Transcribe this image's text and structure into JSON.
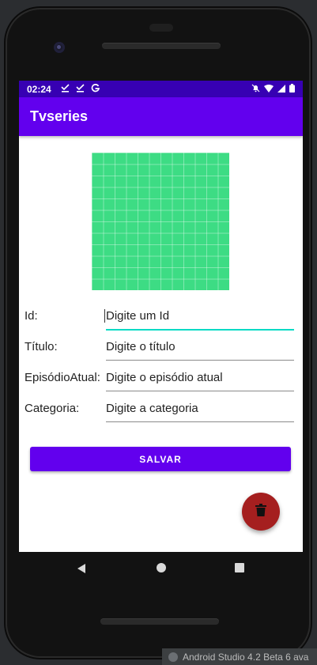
{
  "status_bar": {
    "time": "02:24",
    "left_icons": [
      "download-done-icon",
      "download-done-icon",
      "google-icon"
    ],
    "right_icons": [
      "notifications-off-icon",
      "wifi-icon",
      "signal-icon",
      "battery-icon"
    ]
  },
  "app_bar": {
    "title": "Tvseries"
  },
  "form": {
    "fields": [
      {
        "label": "Id:",
        "placeholder": "Digite um Id",
        "focused": true
      },
      {
        "label": "Título:",
        "placeholder": "Digite o título"
      },
      {
        "label": "EpisódioAtual:",
        "placeholder": "Digite o episódio atual"
      },
      {
        "label": "Categoria:",
        "placeholder": "Digite a categoria"
      }
    ],
    "save_label": "SALVAR"
  },
  "fab": {
    "icon": "delete-icon",
    "color": "#a51f1f"
  },
  "taskbar": {
    "text": "Android Studio 4.2 Beta 6 ava"
  },
  "colors": {
    "primary": "#6200ee",
    "primary_dark": "#3700b3",
    "accent": "#03dac5",
    "image_tile": "#3ddc84"
  }
}
